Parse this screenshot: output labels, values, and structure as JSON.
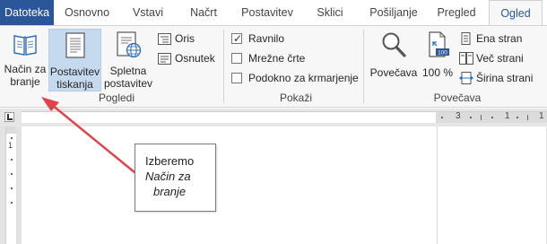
{
  "tabs": [
    {
      "label": "Datoteka"
    },
    {
      "label": "Osnovno"
    },
    {
      "label": "Vstavi"
    },
    {
      "label": "Načrt"
    },
    {
      "label": "Postavitev"
    },
    {
      "label": "Sklici"
    },
    {
      "label": "Pošiljanje"
    },
    {
      "label": "Pregled"
    },
    {
      "label": "Ogled"
    }
  ],
  "ribbon": {
    "views": {
      "reading": {
        "line1": "Način za",
        "line2": "branje",
        "icon": "book-icon"
      },
      "print": {
        "line1": "Postavitev",
        "line2": "tiskanja",
        "icon": "page-icon"
      },
      "web": {
        "line1": "Spletna",
        "line2": "postavitev",
        "icon": "web-page-icon"
      },
      "outline": {
        "label": "Oris",
        "icon": "outline-icon"
      },
      "draft": {
        "label": "Osnutek",
        "icon": "draft-icon"
      },
      "group_label": "Pogledi"
    },
    "show": {
      "ruler": {
        "label": "Ravnilo",
        "checked": true
      },
      "gridlines": {
        "label": "Mrežne črte",
        "checked": false
      },
      "nav_pane": {
        "label": "Podokno za krmarjenje",
        "checked": false
      },
      "group_label": "Pokaži"
    },
    "zoom": {
      "zoom_btn": {
        "label": "Povečava",
        "icon": "magnifier-icon"
      },
      "hundred": {
        "label": "100 %",
        "icon": "zoom-100-icon",
        "badge": "100"
      },
      "one_page": {
        "label": "Ena stran",
        "icon": "one-page-icon"
      },
      "multi_page": {
        "label": "Več strani",
        "icon": "multiple-pages-icon"
      },
      "page_width": {
        "label": "Širina strani",
        "icon": "page-width-icon"
      },
      "group_label": "Povečava"
    }
  },
  "ruler": {
    "numbers": [
      "3",
      "1",
      "1"
    ],
    "vnumber": "1"
  },
  "callout": {
    "line1": "Izberemo",
    "line2": "Način za",
    "line3": "branje"
  },
  "colors": {
    "file_tab": "#2b579a",
    "selected_view": "#c5d9ef",
    "arrow": "#e0434b"
  }
}
